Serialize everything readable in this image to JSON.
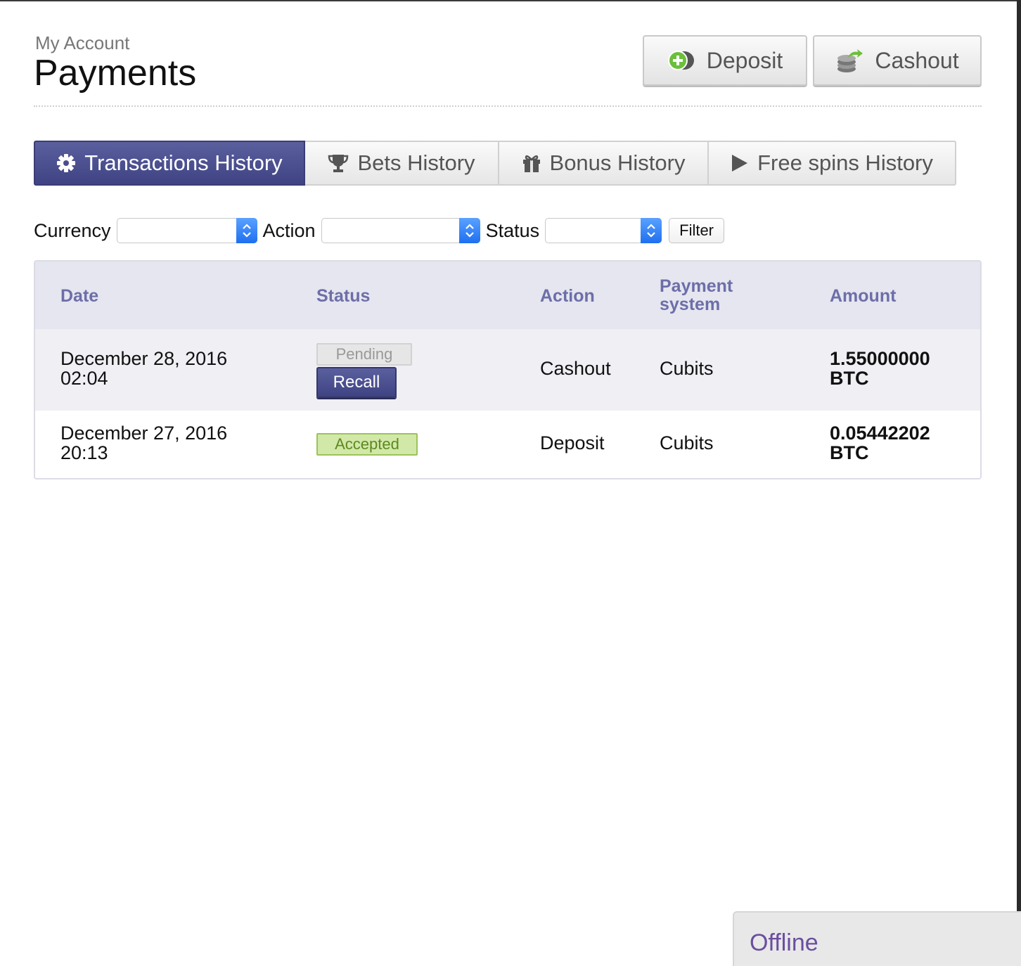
{
  "header": {
    "breadcrumb": "My Account",
    "title": "Payments",
    "deposit_label": "Deposit",
    "cashout_label": "Cashout"
  },
  "tabs": [
    {
      "label": "Transactions History",
      "icon": "gear-icon",
      "active": true
    },
    {
      "label": "Bets History",
      "icon": "trophy-icon",
      "active": false
    },
    {
      "label": "Bonus History",
      "icon": "gift-icon",
      "active": false
    },
    {
      "label": "Free spins History",
      "icon": "play-icon",
      "active": false
    }
  ],
  "filters": {
    "currency_label": "Currency",
    "currency_value": "",
    "action_label": "Action",
    "action_value": "",
    "status_label": "Status",
    "status_value": "",
    "filter_button": "Filter"
  },
  "table": {
    "headers": {
      "date": "Date",
      "status": "Status",
      "action": "Action",
      "payment_system_line1": "Payment",
      "payment_system_line2": "system",
      "amount": "Amount"
    },
    "rows": [
      {
        "date": "December 28, 2016",
        "time": "02:04",
        "status": "Pending",
        "recall": "Recall",
        "action": "Cashout",
        "payment_system": "Cubits",
        "amount": "1.55000000",
        "currency": "BTC"
      },
      {
        "date": "December 27, 2016",
        "time": "20:13",
        "status": "Accepted",
        "action": "Deposit",
        "payment_system": "Cubits",
        "amount": "0.05442202",
        "currency": "BTC"
      }
    ]
  },
  "chat": {
    "status": "Offline"
  },
  "colors": {
    "accent": "#4a4e8e",
    "header_text": "#6d6ea8",
    "accepted_bg": "#d2e8a8",
    "offline_text": "#6a4ea0"
  }
}
